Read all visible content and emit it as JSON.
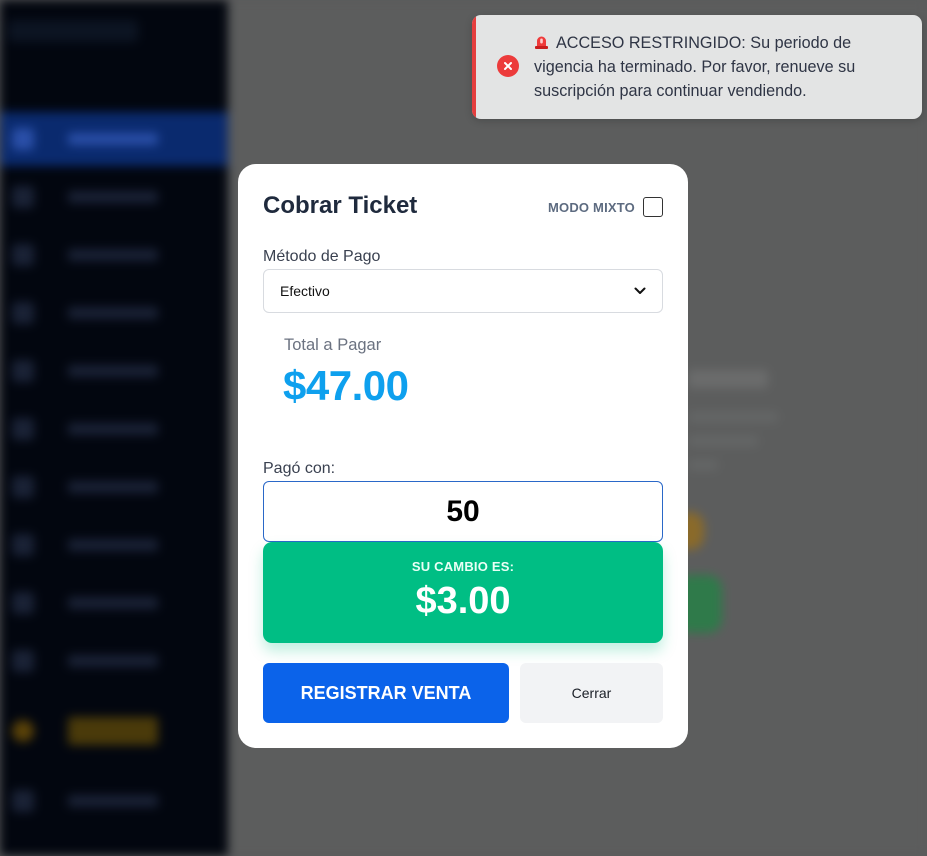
{
  "toast": {
    "emoji_icon": "siren-icon",
    "status_icon": "error-icon",
    "message": "ACCESO RESTRINGIDO: Su periodo de vigencia ha terminado. Por favor, renueve su suscripción para continuar vendiendo.",
    "accent_color": "#e53e3e"
  },
  "modal": {
    "title": "Cobrar Ticket",
    "mixed_mode_label": "MODO MIXTO",
    "mixed_mode_checked": false,
    "payment_method_label": "Método de Pago",
    "payment_method_value": "Efectivo",
    "total_label": "Total a Pagar",
    "total_amount": "$47.00",
    "paid_with_label": "Pagó con:",
    "paid_with_value": "50",
    "change_label": "SU CAMBIO ES:",
    "change_amount": "$3.00",
    "register_button": "REGISTRAR VENTA",
    "close_button": "Cerrar"
  },
  "colors": {
    "primary": "#0b63ea",
    "total": "#0ea0ee",
    "change_bg": "#00be84",
    "error": "#ec3b3b"
  }
}
